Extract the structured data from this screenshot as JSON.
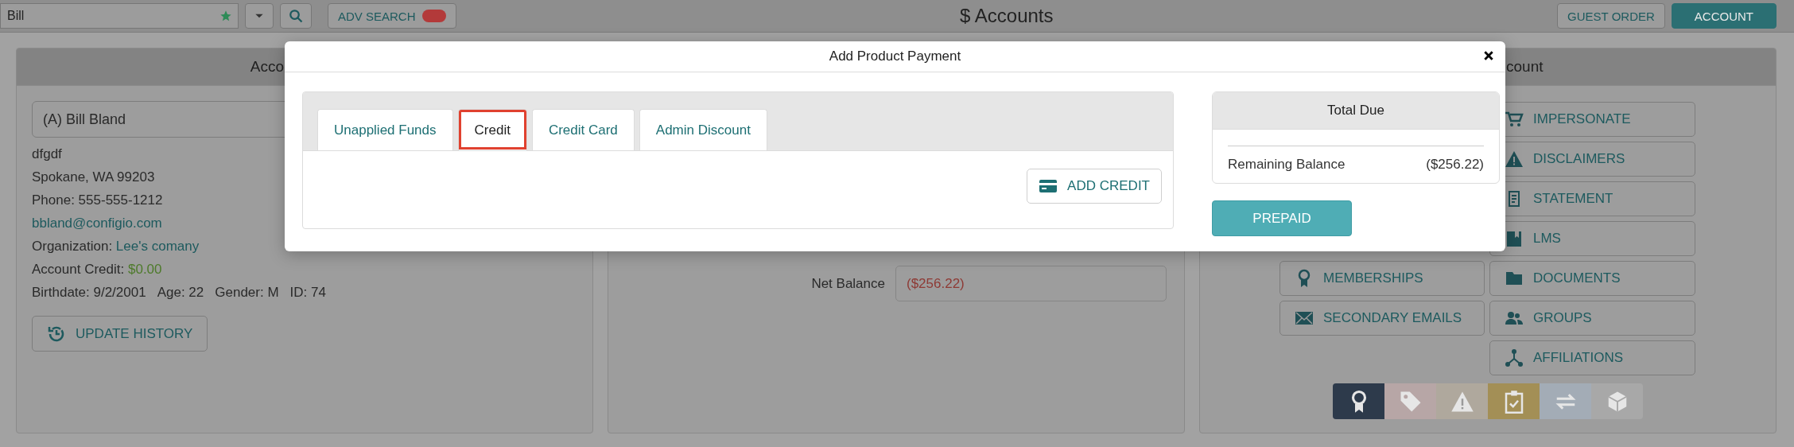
{
  "top_bar": {
    "search": {
      "value": "Bill"
    },
    "adv_search": {
      "label": "ADV SEARCH",
      "on": false
    },
    "title": "$ Accounts",
    "guest_order": "GUEST ORDER",
    "account_button": "ACCOUNT"
  },
  "account_panel": {
    "header": "Acco",
    "name_field": {
      "value": "(A) Bill Bland"
    },
    "address": [
      "dfgdf",
      "Spokane, WA 99203"
    ],
    "phone": "Phone: 555-555-1212",
    "email": "bbland@configio.com",
    "organization": {
      "label": "Organization:",
      "value": "Lee's comany"
    },
    "credit": {
      "label": "Account Credit:",
      "value": "$0.00"
    },
    "details": [
      "Birthdate: 9/2/2001",
      "Age: 22",
      "Gender: M",
      "ID: 74"
    ],
    "update_history": "UPDATE HISTORY"
  },
  "balance_panel": {
    "net_balance": {
      "label": "Net Balance",
      "value": "($256.22)"
    }
  },
  "actions_panel": {
    "header": "count",
    "left_buttons": [
      "MEMBERSHIPS",
      "SECONDARY EMAILS"
    ],
    "right_buttons": [
      "IMPERSONATE",
      "DISCLAIMERS",
      "STATEMENT",
      "LMS",
      "DOCUMENTS",
      "GROUPS",
      "AFFILIATIONS"
    ],
    "status_icons": [
      {
        "color": "#2d3a4b"
      },
      {
        "color": "#b7a6a6"
      },
      {
        "color": "#afa89d"
      },
      {
        "color": "#a38f56"
      },
      {
        "color": "#a3acb6"
      },
      {
        "color": "#a8a8a8"
      }
    ]
  },
  "modal": {
    "title": "Add Product Payment",
    "tabs": [
      {
        "label": "Unapplied Funds",
        "selected": false
      },
      {
        "label": "Credit",
        "selected": true
      },
      {
        "label": "Credit Card",
        "selected": false
      },
      {
        "label": "Admin Discount",
        "selected": false
      }
    ],
    "add_credit": "ADD CREDIT",
    "total_due": {
      "title": "Total Due",
      "label": "Remaining Balance",
      "value": "($256.22)"
    },
    "prepaid": "PREPAID"
  }
}
